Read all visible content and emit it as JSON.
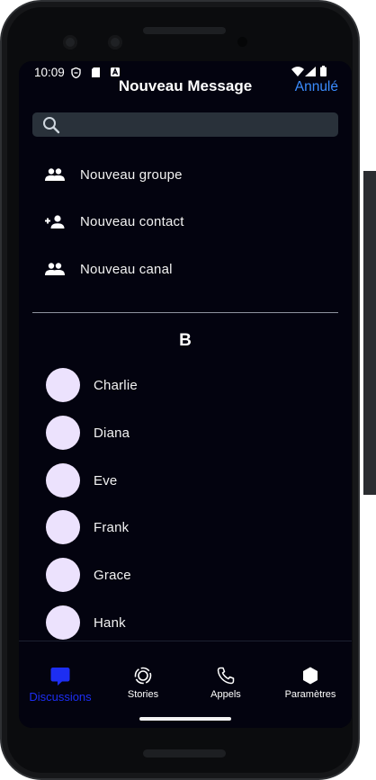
{
  "status_bar": {
    "time": "10:09"
  },
  "header": {
    "title": "Nouveau Message",
    "cancel_label": "Annulé"
  },
  "search": {
    "placeholder": ""
  },
  "actions": [
    {
      "label": "Nouveau groupe",
      "icon": "group-icon"
    },
    {
      "label": "Nouveau contact",
      "icon": "add-contact-icon"
    },
    {
      "label": "Nouveau canal",
      "icon": "channel-icon"
    }
  ],
  "section": {
    "letter": "B"
  },
  "contacts": [
    {
      "name": "Charlie"
    },
    {
      "name": "Diana"
    },
    {
      "name": "Eve"
    },
    {
      "name": "Frank"
    },
    {
      "name": "Grace"
    },
    {
      "name": "Hank"
    }
  ],
  "tabs": [
    {
      "label": "Discussions",
      "icon": "chat-bubble-icon",
      "active": true
    },
    {
      "label": "Stories",
      "icon": "stories-icon",
      "active": false
    },
    {
      "label": "Appels",
      "icon": "phone-icon",
      "active": false
    },
    {
      "label": "Paramètres",
      "icon": "hexagon-icon",
      "active": false
    }
  ],
  "colors": {
    "screen_bg": "#03030f",
    "accent_link": "#3b8cff",
    "active_tab": "#1d2ef2",
    "avatar": "#ece2fd"
  }
}
